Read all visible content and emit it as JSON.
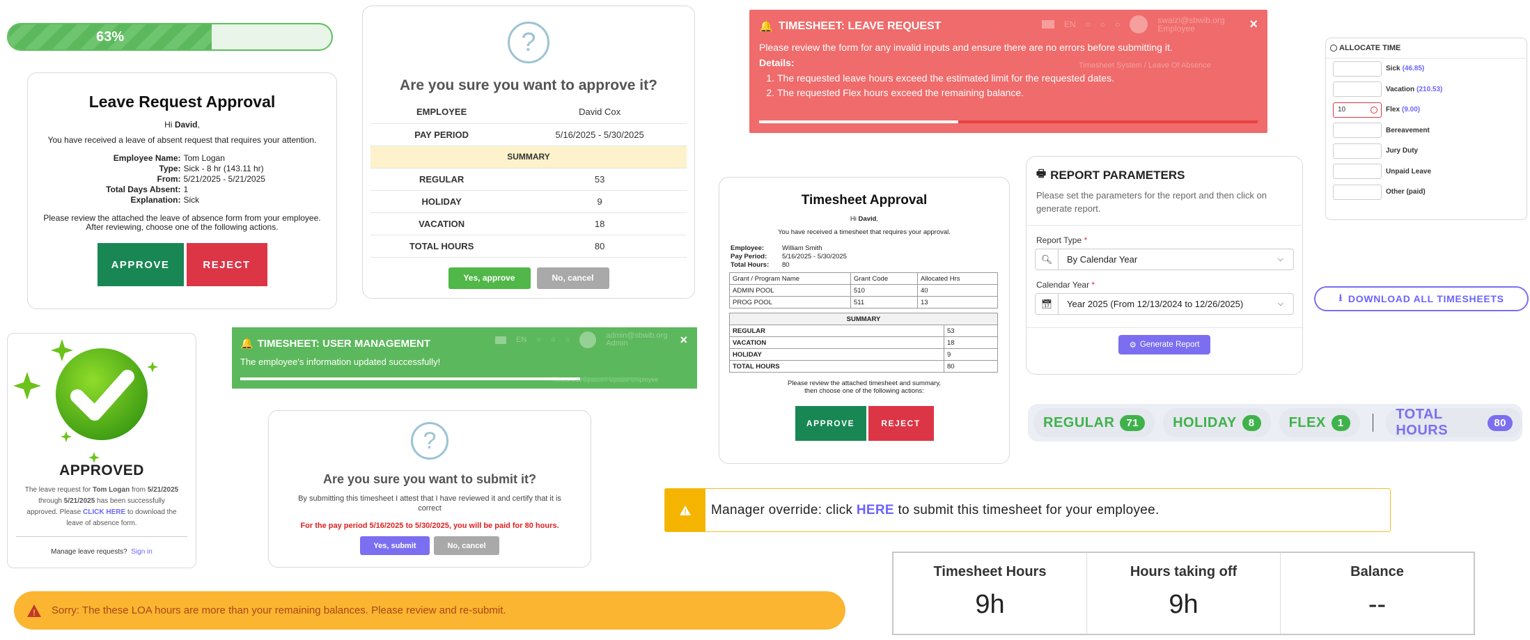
{
  "progress": {
    "label": "63%",
    "value": 0.63
  },
  "leave_approval": {
    "title": "Leave Request Approval",
    "greeting_prefix": "Hi ",
    "greeting_name": "David",
    "greeting_suffix": ",",
    "intro": "You have received a leave of absent request that requires your attention.",
    "fields": [
      {
        "k": "Employee Name:",
        "v": "Tom Logan"
      },
      {
        "k": "Type:",
        "v": "Sick - 8 hr (143.11 hr)"
      },
      {
        "k": "From:",
        "v": "5/21/2025 - 5/21/2025"
      },
      {
        "k": "Total Days Absent:",
        "v": "1"
      },
      {
        "k": "Explanation:",
        "v": "Sick"
      }
    ],
    "note1": "Please review the attached the leave of absence form from your employee.",
    "note2": "After reviewing, choose one of the following actions.",
    "approve": "APPROVE",
    "reject": "REJECT"
  },
  "approve_modal": {
    "icon": "?",
    "title": "Are you sure you want to approve it?",
    "employee_label": "EMPLOYEE",
    "employee": "David Cox",
    "period_label": "PAY PERIOD",
    "period": "5/16/2025 - 5/30/2025",
    "summary": "SUMMARY",
    "rows": [
      {
        "k": "REGULAR",
        "v": "53"
      },
      {
        "k": "HOLIDAY",
        "v": "9"
      },
      {
        "k": "VACATION",
        "v": "18"
      },
      {
        "k": "TOTAL HOURS",
        "v": "80"
      }
    ],
    "yes": "Yes, approve",
    "no": "No, cancel"
  },
  "leave_notification": {
    "title": "TIMESHEET: LEAVE REQUEST",
    "message": "Please review the form for any invalid inputs and ensure there are no errors before submitting it.",
    "details_label": "Details",
    "details": [
      "The requested leave hours exceed the estimated limit for the requested dates.",
      "The requested Flex hours exceed the remaining balance."
    ],
    "bg_lang": "EN",
    "bg_email": "swaizi@sbwib.org",
    "bg_role": "Employee",
    "bg_breadcrumb": "Timesheet System  /  Leave Of Absence",
    "close": "×",
    "timer": 0.4
  },
  "allocate": {
    "title": "ALLOCATE TIME",
    "rows": [
      {
        "label": "Sick",
        "balance": "(46.85)",
        "value": ""
      },
      {
        "label": "Vacation",
        "balance": "(210.53)",
        "value": ""
      },
      {
        "label": "Flex",
        "balance": "(9.00)",
        "value": "10"
      },
      {
        "label": "Bereavement",
        "balance": "",
        "value": ""
      },
      {
        "label": "Jury Duty",
        "balance": "",
        "value": ""
      },
      {
        "label": "Unpaid Leave",
        "balance": "",
        "value": ""
      },
      {
        "label": "Other (paid)",
        "balance": "",
        "value": ""
      }
    ]
  },
  "ts_approval": {
    "title": "Timesheet Approval",
    "greeting_prefix": "Hi ",
    "greeting_name": "David",
    "greeting_suffix": ",",
    "intro": "You have received a timesheet that requires your approval.",
    "info": [
      {
        "k": "Employee:",
        "v": "William Smith"
      },
      {
        "k": "Pay Period:",
        "v": "5/16/2025 - 5/30/2025"
      },
      {
        "k": "Total Hours:",
        "v": "80"
      }
    ],
    "grant_headers": [
      "Grant / Program Name",
      "Grant Code",
      "Allocated Hrs"
    ],
    "grants": [
      [
        "ADMIN POOL",
        "510",
        "40"
      ],
      [
        "PROG POOL",
        "511",
        "13"
      ]
    ],
    "summary": "SUMMARY",
    "summary_rows": [
      [
        "REGULAR",
        "53"
      ],
      [
        "VACATION",
        "18"
      ],
      [
        "HOLIDAY",
        "9"
      ],
      [
        "TOTAL HOURS",
        "80"
      ]
    ],
    "note1": "Please review the attached timesheet and summary,",
    "note2": "then choose one of the following actions:",
    "approve": "APPROVE",
    "reject": "REJECT"
  },
  "report": {
    "title": "REPORT PARAMETERS",
    "desc": "Please set the parameters for the report and then click on generate report.",
    "type_label": "Report Type",
    "type_value": "By Calendar Year",
    "year_label": "Calendar Year",
    "year_value": "Year 2025 (From 12/13/2024 to 12/26/2025)",
    "required": "*",
    "generate": "Generate Report"
  },
  "download": {
    "label": "DOWNLOAD ALL TIMESHEETS"
  },
  "pills": [
    {
      "label": "REGULAR",
      "count": "71",
      "color": "#3fb24b"
    },
    {
      "label": "HOLIDAY",
      "count": "8",
      "color": "#3fb24b"
    },
    {
      "label": "FLEX",
      "count": "1",
      "color": "#3fb24b"
    },
    {
      "label": "TOTAL HOURS",
      "count": "80",
      "color": "#7b6ef0"
    }
  ],
  "approved": {
    "title": "APPROVED",
    "l1a": "The leave request for ",
    "l1b": "Tom Logan",
    "l1c": " from ",
    "l1d": "5/21/2025",
    "l2a": "through ",
    "l2b": "5/21/2025",
    "l2c": " has been successfully",
    "l3a": "approved. Please ",
    "l3b": "CLICK HERE",
    "l3c": " to download the",
    "l4": "leave of absence form.",
    "footer": "Manage leave requests?",
    "signin": "Sign in"
  },
  "user_notification": {
    "title": "TIMESHEET: USER MANAGEMENT",
    "message": "The employee's information updated successfully!",
    "bg_lang": "EN",
    "bg_email": "admin@sbwib.org",
    "bg_role": "Admin",
    "bg_breadcrumb": "Timesheet System  /  Update employee",
    "close": "×",
    "timer": 0.85
  },
  "submit_modal": {
    "icon": "?",
    "title": "Are you sure you want to submit it?",
    "body": "By submitting this timesheet I attest that I have reviewed it and certify that it is correct",
    "warning": "For the pay period 5/16/2025 to 5/30/2025, you will be paid for 80 hours.",
    "yes": "Yes, submit",
    "no": "No, cancel"
  },
  "override": {
    "icon": "!",
    "prefix": "Manager override: click ",
    "link": "HERE",
    "suffix": " to submit this timesheet for your employee."
  },
  "stats": [
    {
      "title": "Timesheet Hours",
      "value": "9h"
    },
    {
      "title": "Hours taking off",
      "value": "9h"
    },
    {
      "title": "Balance",
      "value": "--"
    }
  ],
  "sorry": {
    "message": "Sorry: The these LOA hours are more than your remaining balances. Please review and re-submit."
  }
}
